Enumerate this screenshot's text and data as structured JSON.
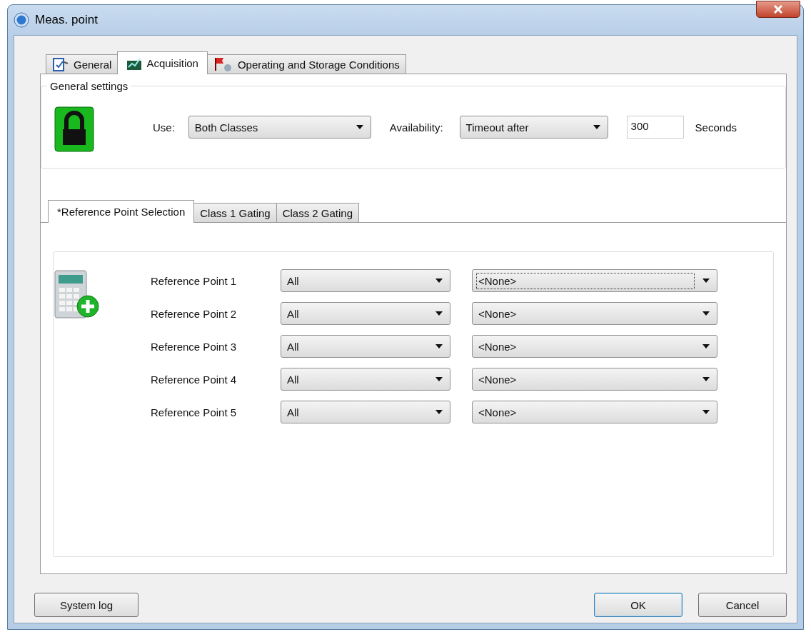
{
  "window": {
    "title": "Meas. point"
  },
  "tabs": [
    {
      "label": "General",
      "kind": "general",
      "selected": false
    },
    {
      "label": "Acquisition",
      "kind": "acquisition",
      "selected": true
    },
    {
      "label": "Operating and Storage Conditions",
      "kind": "conditions",
      "selected": false
    }
  ],
  "general_settings": {
    "title": "General settings",
    "use_label": "Use:",
    "use_value": "Both Classes",
    "availability_label": "Availability:",
    "availability_value": "Timeout after",
    "timeout_value": "300",
    "timeout_unit": "Seconds"
  },
  "subtabs": [
    {
      "label": "*Reference Point Selection",
      "selected": true
    },
    {
      "label": "Class 1 Gating",
      "selected": false
    },
    {
      "label": "Class 2 Gating",
      "selected": false
    }
  ],
  "reference_points": [
    {
      "label": "Reference Point 1",
      "filter": "All",
      "point": "<None>",
      "focused": true
    },
    {
      "label": "Reference Point 2",
      "filter": "All",
      "point": "<None>",
      "focused": false
    },
    {
      "label": "Reference Point 3",
      "filter": "All",
      "point": "<None>",
      "focused": false
    },
    {
      "label": "Reference Point 4",
      "filter": "All",
      "point": "<None>",
      "focused": false
    },
    {
      "label": "Reference Point 5",
      "filter": "All",
      "point": "<None>",
      "focused": false
    }
  ],
  "buttons": [
    {
      "label": "System log",
      "default": false
    },
    {
      "label": "OK",
      "default": true
    },
    {
      "label": "Cancel",
      "default": false
    }
  ]
}
